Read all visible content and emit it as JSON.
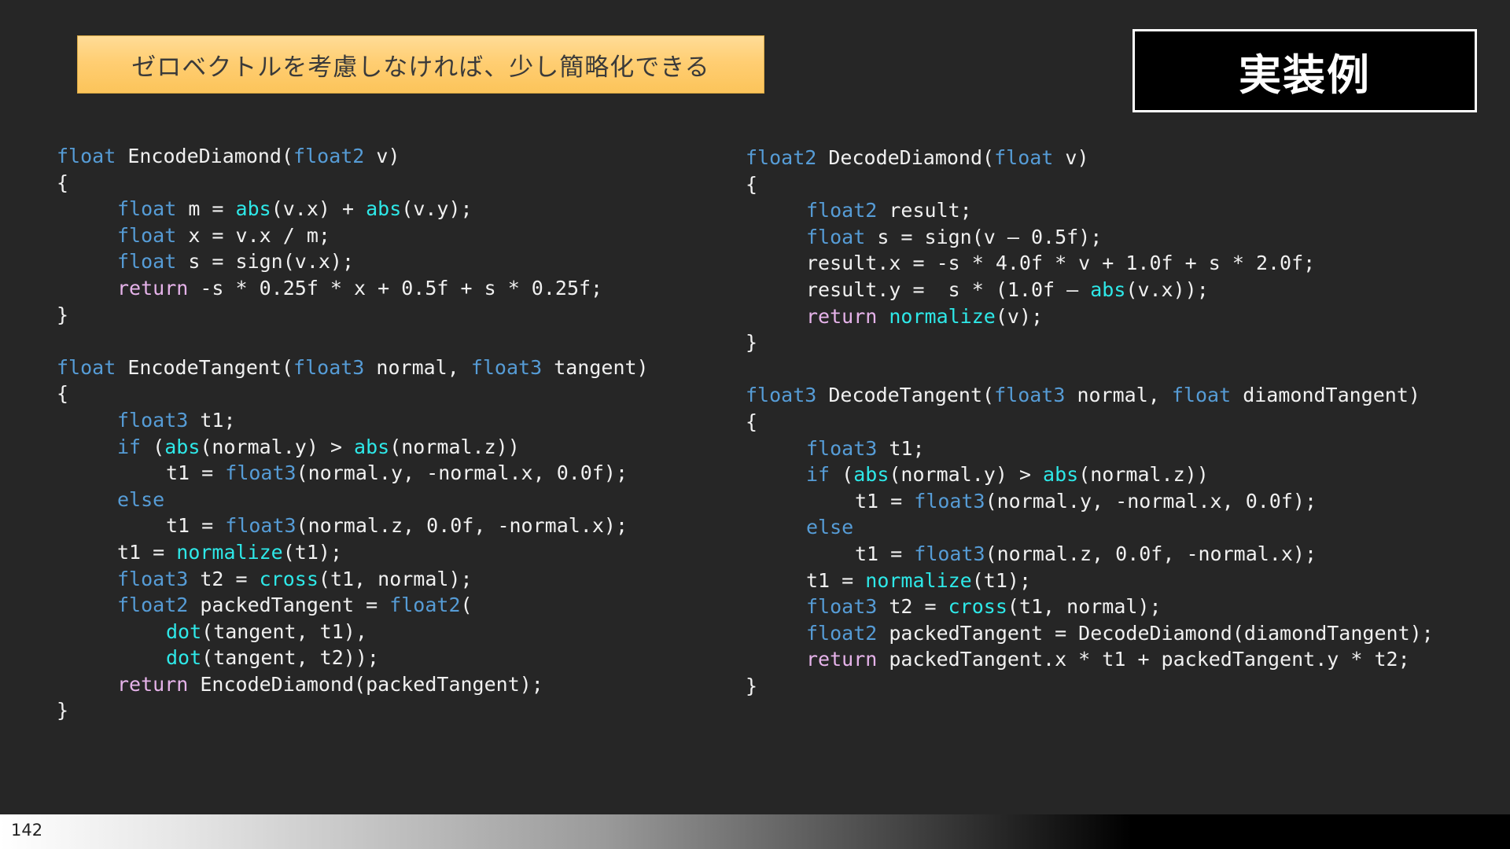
{
  "callout_text": "ゼロベクトルを考慮しなければ、少し簡略化できる",
  "title": "実装例",
  "page_number": "142",
  "colors": {
    "background": "#262626",
    "keyword": "#569cd6",
    "builtin_function": "#2ee8e8",
    "return_keyword": "#e6b3ea",
    "code_text": "#f0f0f0",
    "callout_fill": "#ffce73"
  },
  "code_left": [
    {
      "indent": 0,
      "tokens": [
        [
          "kw",
          "float"
        ],
        [
          "t",
          " EncodeDiamond("
        ],
        [
          "kw",
          "float2"
        ],
        [
          "t",
          " v)"
        ]
      ]
    },
    {
      "indent": 0,
      "tokens": [
        [
          "t",
          "{"
        ]
      ]
    },
    {
      "indent": 1,
      "tokens": [
        [
          "kw",
          "float"
        ],
        [
          "t",
          " m = "
        ],
        [
          "fn",
          "abs"
        ],
        [
          "t",
          "(v.x) + "
        ],
        [
          "fn",
          "abs"
        ],
        [
          "t",
          "(v.y);"
        ]
      ]
    },
    {
      "indent": 1,
      "tokens": [
        [
          "kw",
          "float"
        ],
        [
          "t",
          " x = v.x / m;"
        ]
      ]
    },
    {
      "indent": 1,
      "tokens": [
        [
          "kw",
          "float"
        ],
        [
          "t",
          " s = sign(v.x);"
        ]
      ]
    },
    {
      "indent": 1,
      "tokens": [
        [
          "ret",
          "return"
        ],
        [
          "t",
          " -s * 0.25f * x + 0.5f + s * 0.25f;"
        ]
      ]
    },
    {
      "indent": 0,
      "tokens": [
        [
          "t",
          "}"
        ]
      ]
    },
    {
      "blank": true
    },
    {
      "indent": 0,
      "tokens": [
        [
          "kw",
          "float"
        ],
        [
          "t",
          " EncodeTangent("
        ],
        [
          "kw",
          "float3"
        ],
        [
          "t",
          " normal, "
        ],
        [
          "kw",
          "float3"
        ],
        [
          "t",
          " tangent)"
        ]
      ]
    },
    {
      "indent": 0,
      "tokens": [
        [
          "t",
          "{"
        ]
      ]
    },
    {
      "indent": 1,
      "tokens": [
        [
          "kw",
          "float3"
        ],
        [
          "t",
          " t1;"
        ]
      ]
    },
    {
      "indent": 1,
      "tokens": [
        [
          "kw",
          "if"
        ],
        [
          "t",
          " ("
        ],
        [
          "fn",
          "abs"
        ],
        [
          "t",
          "(normal.y) > "
        ],
        [
          "fn",
          "abs"
        ],
        [
          "t",
          "(normal.z))"
        ]
      ]
    },
    {
      "indent": 2,
      "tokens": [
        [
          "t",
          "t1 = "
        ],
        [
          "kw",
          "float3"
        ],
        [
          "t",
          "(normal.y, -normal.x, 0.0f);"
        ]
      ]
    },
    {
      "indent": 1,
      "tokens": [
        [
          "kw",
          "else"
        ]
      ]
    },
    {
      "indent": 2,
      "tokens": [
        [
          "t",
          "t1 = "
        ],
        [
          "kw",
          "float3"
        ],
        [
          "t",
          "(normal.z, 0.0f, -normal.x);"
        ]
      ]
    },
    {
      "indent": 1,
      "tokens": [
        [
          "t",
          "t1 = "
        ],
        [
          "fn",
          "normalize"
        ],
        [
          "t",
          "(t1);"
        ]
      ]
    },
    {
      "indent": 1,
      "tokens": [
        [
          "kw",
          "float3"
        ],
        [
          "t",
          " t2 = "
        ],
        [
          "fn",
          "cross"
        ],
        [
          "t",
          "(t1, normal);"
        ]
      ]
    },
    {
      "indent": 1,
      "tokens": [
        [
          "kw",
          "float2"
        ],
        [
          "t",
          " packedTangent = "
        ],
        [
          "kw",
          "float2"
        ],
        [
          "t",
          "("
        ]
      ]
    },
    {
      "indent": 2,
      "tokens": [
        [
          "fn",
          "dot"
        ],
        [
          "t",
          "(tangent, t1),"
        ]
      ]
    },
    {
      "indent": 2,
      "tokens": [
        [
          "fn",
          "dot"
        ],
        [
          "t",
          "(tangent, t2));"
        ]
      ]
    },
    {
      "indent": 1,
      "tokens": [
        [
          "ret",
          "return"
        ],
        [
          "t",
          " EncodeDiamond(packedTangent);"
        ]
      ]
    },
    {
      "indent": 0,
      "tokens": [
        [
          "t",
          "}"
        ]
      ]
    }
  ],
  "code_right": [
    {
      "indent": 0,
      "tokens": [
        [
          "kw",
          "float2"
        ],
        [
          "t",
          " DecodeDiamond("
        ],
        [
          "kw",
          "float"
        ],
        [
          "t",
          " v)"
        ]
      ]
    },
    {
      "indent": 0,
      "tokens": [
        [
          "t",
          "{"
        ]
      ]
    },
    {
      "indent": 1,
      "tokens": [
        [
          "kw",
          "float2"
        ],
        [
          "t",
          " result;"
        ]
      ]
    },
    {
      "indent": 1,
      "tokens": [
        [
          "kw",
          "float"
        ],
        [
          "t",
          " s = sign(v – 0.5f);"
        ]
      ]
    },
    {
      "indent": 1,
      "tokens": [
        [
          "t",
          "result.x = -s * 4.0f * v + 1.0f + s * 2.0f;"
        ]
      ]
    },
    {
      "indent": 1,
      "tokens": [
        [
          "t",
          "result.y =  s * (1.0f – "
        ],
        [
          "fn",
          "abs"
        ],
        [
          "t",
          "(v.x));"
        ]
      ]
    },
    {
      "indent": 1,
      "tokens": [
        [
          "ret",
          "return"
        ],
        [
          "t",
          " "
        ],
        [
          "fn",
          "normalize"
        ],
        [
          "t",
          "(v);"
        ]
      ]
    },
    {
      "indent": 0,
      "tokens": [
        [
          "t",
          "}"
        ]
      ]
    },
    {
      "blank": true
    },
    {
      "indent": 0,
      "tokens": [
        [
          "kw",
          "float3"
        ],
        [
          "t",
          " DecodeTangent("
        ],
        [
          "kw",
          "float3"
        ],
        [
          "t",
          " normal, "
        ],
        [
          "kw",
          "float"
        ],
        [
          "t",
          " diamondTangent)"
        ]
      ]
    },
    {
      "indent": 0,
      "tokens": [
        [
          "t",
          "{"
        ]
      ]
    },
    {
      "indent": 1,
      "tokens": [
        [
          "kw",
          "float3"
        ],
        [
          "t",
          " t1;"
        ]
      ]
    },
    {
      "indent": 1,
      "tokens": [
        [
          "kw",
          "if"
        ],
        [
          "t",
          " ("
        ],
        [
          "fn",
          "abs"
        ],
        [
          "t",
          "(normal.y) > "
        ],
        [
          "fn",
          "abs"
        ],
        [
          "t",
          "(normal.z))"
        ]
      ]
    },
    {
      "indent": 2,
      "tokens": [
        [
          "t",
          "t1 = "
        ],
        [
          "kw",
          "float3"
        ],
        [
          "t",
          "(normal.y, -normal.x, 0.0f);"
        ]
      ]
    },
    {
      "indent": 1,
      "tokens": [
        [
          "kw",
          "else"
        ]
      ]
    },
    {
      "indent": 2,
      "tokens": [
        [
          "t",
          "t1 = "
        ],
        [
          "kw",
          "float3"
        ],
        [
          "t",
          "(normal.z, 0.0f, -normal.x);"
        ]
      ]
    },
    {
      "indent": 1,
      "tokens": [
        [
          "t",
          "t1 = "
        ],
        [
          "fn",
          "normalize"
        ],
        [
          "t",
          "(t1);"
        ]
      ]
    },
    {
      "indent": 1,
      "tokens": [
        [
          "kw",
          "float3"
        ],
        [
          "t",
          " t2 = "
        ],
        [
          "fn",
          "cross"
        ],
        [
          "t",
          "(t1, normal);"
        ]
      ]
    },
    {
      "indent": 1,
      "tokens": [
        [
          "kw",
          "float2"
        ],
        [
          "t",
          " packedTangent = DecodeDiamond(diamondTangent);"
        ]
      ]
    },
    {
      "indent": 1,
      "tokens": [
        [
          "ret",
          "return"
        ],
        [
          "t",
          " packedTangent.x * t1 + packedTangent.y * t2;"
        ]
      ]
    },
    {
      "indent": 0,
      "tokens": [
        [
          "t",
          "}"
        ]
      ]
    }
  ]
}
